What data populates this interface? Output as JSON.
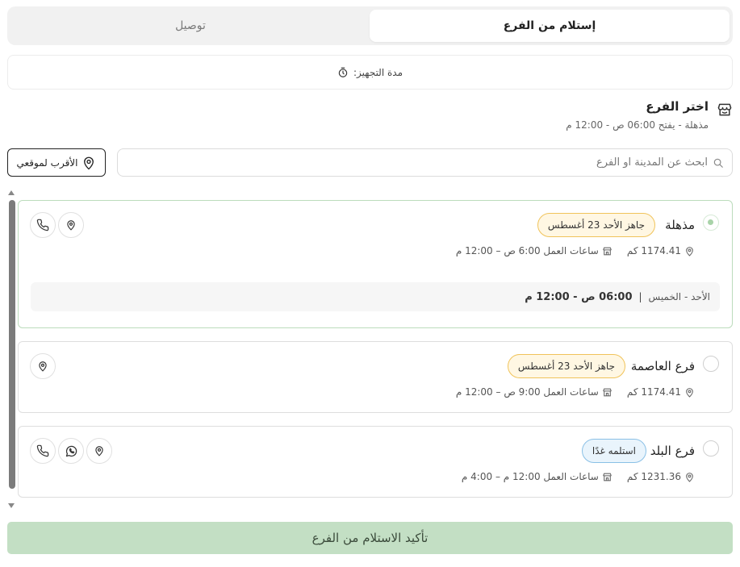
{
  "tabs": {
    "pickup_label": "إستلام من الفرع",
    "delivery_label": "توصيل",
    "active": "pickup"
  },
  "prep": {
    "label": "مدة التجهيز:"
  },
  "branch_selector": {
    "title": "اختر الفرع",
    "selected_summary": "مذهلة  -  يفتح 06:00 ص - 12:00 م"
  },
  "search": {
    "placeholder": "ابحث عن المدينة او الفرع",
    "nearest_label": "الأقرب لموقعي"
  },
  "branches": [
    {
      "name": "مذهلة",
      "badge": "جاهز الأحد 23 أغسطس",
      "distance": "1174.41 كم",
      "hours": "ساعات العمل 6:00 ص – 12:00 م",
      "schedule_days": "الأحد - الخميس",
      "schedule_sep": "|",
      "schedule_time": "06:00 ص - 12:00 م",
      "selected": true
    },
    {
      "name": "فرع العاصمة",
      "badge": "جاهز الأحد 23 أغسطس",
      "distance": "1174.41 كم",
      "hours": "ساعات العمل 9:00 ص – 12:00 م",
      "selected": false
    },
    {
      "name": "فرع البلد",
      "badge": "استلمه غدًا",
      "distance": "1231.36 كم",
      "hours": "ساعات العمل 12:00 م – 4:00 م",
      "selected": false
    }
  ],
  "confirm": {
    "label": "تأكيد الاستلام من الفرع"
  },
  "colors": {
    "accent_green": "#c3dfc4",
    "badge_ready_border": "#f0c35a",
    "badge_tomorrow_border": "#8ac0e6",
    "selected_border": "#bcdcbc"
  }
}
